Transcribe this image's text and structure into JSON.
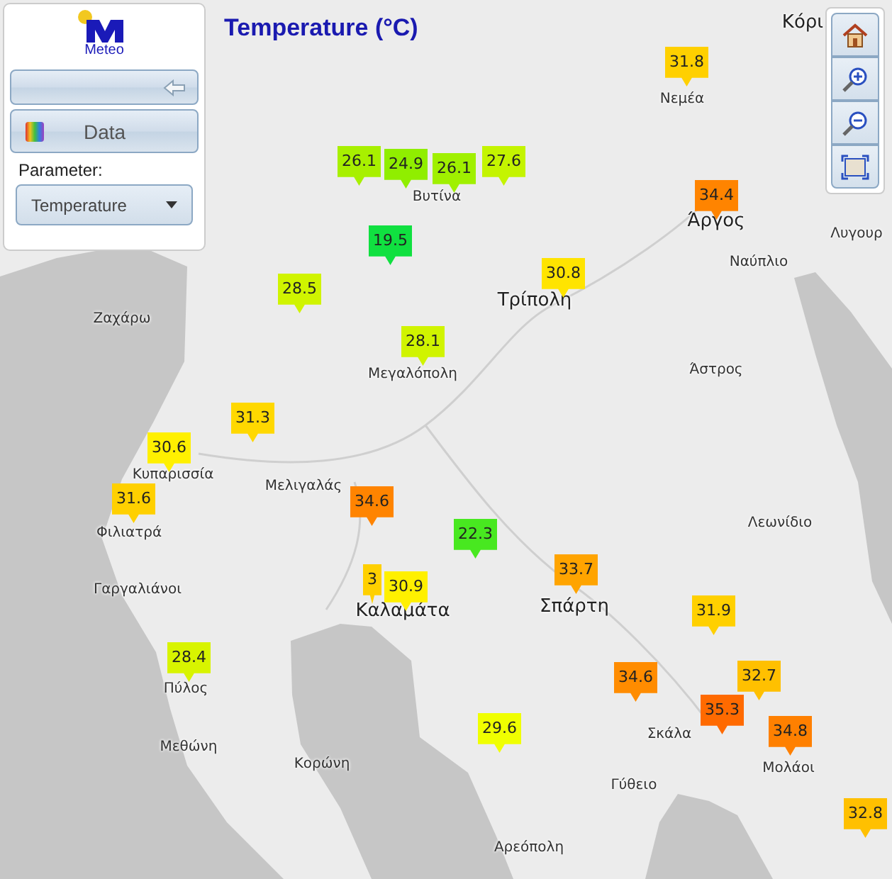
{
  "panel": {
    "logo_text": "Meteo",
    "data_button": "Data",
    "parameter_label": "Parameter:",
    "parameter_select": "Temperature"
  },
  "title": "Temperature (°C)",
  "places": [
    {
      "name": "Κόρι",
      "kind": "city"
    },
    {
      "name": "Νεμέα",
      "kind": "town"
    },
    {
      "name": "Άργος",
      "kind": "city"
    },
    {
      "name": "Ναύπλιο",
      "kind": "town"
    },
    {
      "name": "Λυγουρ",
      "kind": "town"
    },
    {
      "name": "Βυτίνα",
      "kind": "town"
    },
    {
      "name": "Τρίπολη",
      "kind": "city"
    },
    {
      "name": "Ζαχάρω",
      "kind": "town"
    },
    {
      "name": "Μεγαλόπολη",
      "kind": "town"
    },
    {
      "name": "Άστρος",
      "kind": "town"
    },
    {
      "name": "Κυπαρισσία",
      "kind": "town"
    },
    {
      "name": "Φιλιατρά",
      "kind": "town"
    },
    {
      "name": "Μελιγαλάς",
      "kind": "town"
    },
    {
      "name": "Λεωνίδιο",
      "kind": "town"
    },
    {
      "name": "Γαργαλιάνοι",
      "kind": "town"
    },
    {
      "name": "Καλαμάτα",
      "kind": "city"
    },
    {
      "name": "Σπάρτη",
      "kind": "city"
    },
    {
      "name": "Πύλος",
      "kind": "town"
    },
    {
      "name": "Σκάλα",
      "kind": "town"
    },
    {
      "name": "Μεθώνη",
      "kind": "town"
    },
    {
      "name": "Κορώνη",
      "kind": "town"
    },
    {
      "name": "Μολάοι",
      "kind": "town"
    },
    {
      "name": "Γύθειο",
      "kind": "town"
    },
    {
      "name": "Αρεόπολη",
      "kind": "town"
    }
  ],
  "markers": [
    {
      "value": "31.8",
      "color": "#ffd000"
    },
    {
      "value": "34.4",
      "color": "#ff8400"
    },
    {
      "value": "26.1",
      "color": "#a8f000"
    },
    {
      "value": "24.9",
      "color": "#90ee00"
    },
    {
      "value": "26.1",
      "color": "#a0f000"
    },
    {
      "value": "27.6",
      "color": "#c4f400"
    },
    {
      "value": "19.5",
      "color": "#10e040"
    },
    {
      "value": "28.5",
      "color": "#d0f400"
    },
    {
      "value": "30.8",
      "color": "#ffe400"
    },
    {
      "value": "28.1",
      "color": "#d0f400"
    },
    {
      "value": "31.3",
      "color": "#ffd800"
    },
    {
      "value": "30.6",
      "color": "#fff000"
    },
    {
      "value": "31.6",
      "color": "#ffd000"
    },
    {
      "value": "34.6",
      "color": "#ff8400"
    },
    {
      "value": "22.3",
      "color": "#48e820"
    },
    {
      "value": "3",
      "color": "#ffd000"
    },
    {
      "value": "30.9",
      "color": "#fff000"
    },
    {
      "value": "33.7",
      "color": "#ffa400"
    },
    {
      "value": "31.9",
      "color": "#ffd000"
    },
    {
      "value": "28.4",
      "color": "#d8f400"
    },
    {
      "value": "34.6",
      "color": "#ff8c00"
    },
    {
      "value": "32.7",
      "color": "#ffc000"
    },
    {
      "value": "29.6",
      "color": "#f0ff00"
    },
    {
      "value": "35.3",
      "color": "#ff6a00"
    },
    {
      "value": "34.8",
      "color": "#ff8000"
    },
    {
      "value": "32.8",
      "color": "#ffc000"
    }
  ],
  "map_controls": [
    {
      "kind": "home"
    },
    {
      "kind": "zoom_in"
    },
    {
      "kind": "zoom_out"
    },
    {
      "kind": "extent"
    }
  ]
}
